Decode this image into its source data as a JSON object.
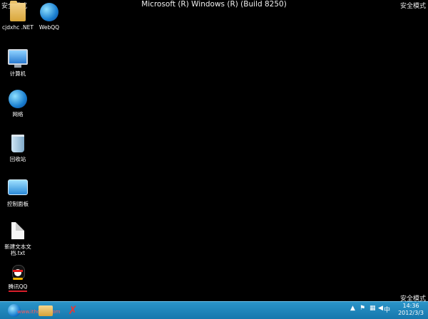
{
  "desktop": {
    "mode_top_left": "安全模式",
    "mode_top_right": "安全模式",
    "mode_bottom_right": "安全模式",
    "build_text": "Microsoft (R) Windows (R) (Build 8250)",
    "icons": [
      {
        "name": "cjdxhc .NET",
        "icon": "folder-icon"
      },
      {
        "name": "WebQQ",
        "icon": "globe-icon"
      },
      {
        "name": "计算机",
        "icon": "computer-icon"
      },
      {
        "name": "网络",
        "icon": "network-icon"
      },
      {
        "name": "回收站",
        "icon": "recycle-bin-icon"
      },
      {
        "name": "控制面板",
        "icon": "control-panel-icon"
      },
      {
        "name": "新建文本文档.txt",
        "icon": "text-document-icon"
      },
      {
        "name": "腾讯QQ",
        "icon": "qq-penguin-icon"
      }
    ]
  },
  "taskbar": {
    "watermark": "www.ithome.com",
    "pinned": [
      "internet-explorer-icon",
      "file-explorer-icon",
      "x-app-icon"
    ],
    "tray": {
      "arrow": "▲",
      "ime": "中"
    },
    "clock": {
      "time": "14:36",
      "date": "2012/3/3"
    },
    "colors": {
      "bar": "#1677ad",
      "accent": "#d81e2a"
    }
  }
}
